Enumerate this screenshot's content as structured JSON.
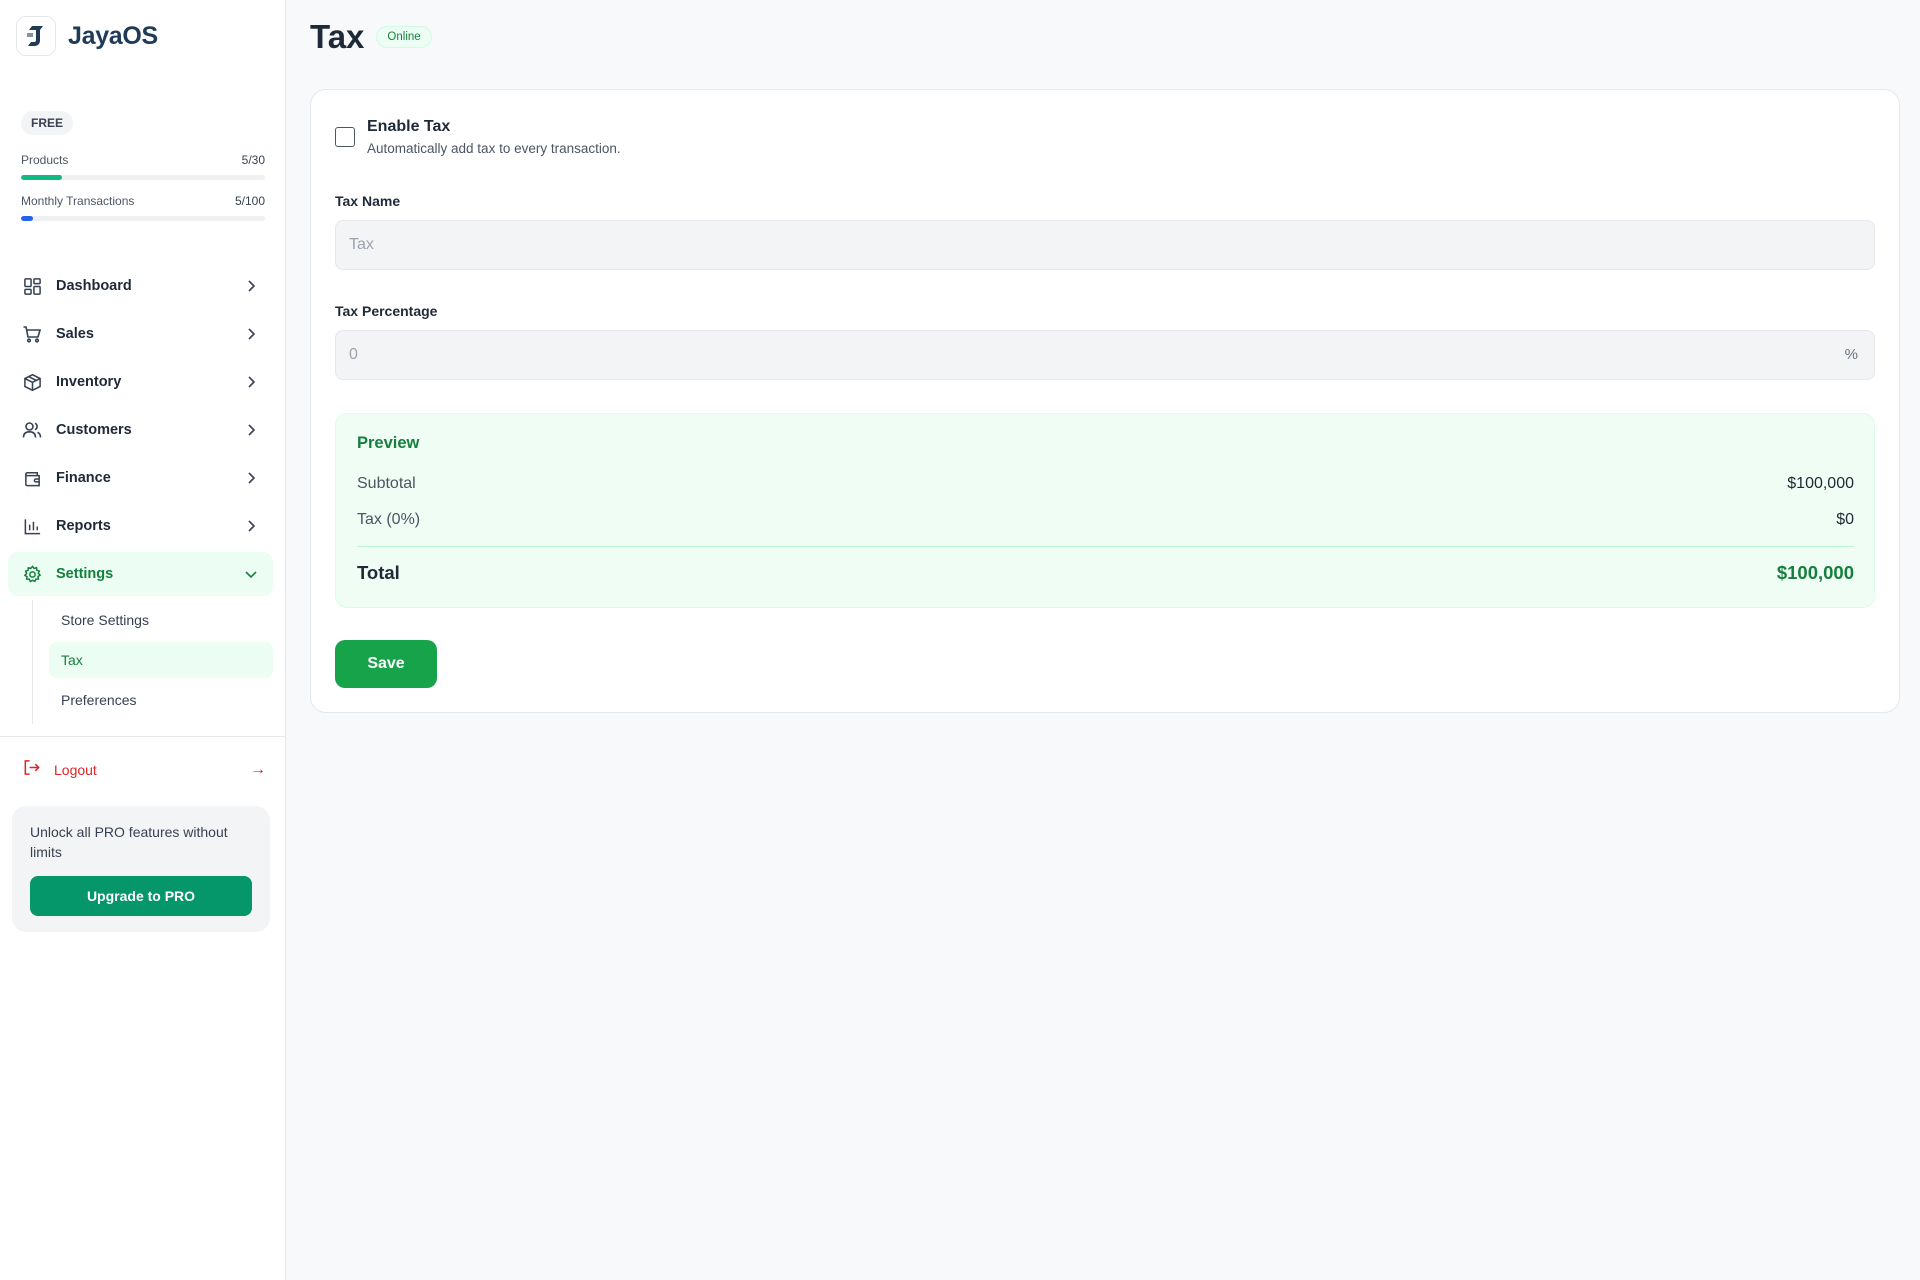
{
  "brand": {
    "name": "JayaOS"
  },
  "plan": {
    "badge": "FREE",
    "usage": [
      {
        "label": "Products",
        "count": "5/30",
        "fraction": 0.1667,
        "color": "#10b981"
      },
      {
        "label": "Monthly Transactions",
        "count": "5/100",
        "fraction": 0.05,
        "color": "#2563eb"
      }
    ]
  },
  "nav": {
    "items": [
      {
        "label": "Dashboard",
        "icon": "dashboard-icon"
      },
      {
        "label": "Sales",
        "icon": "cart-icon"
      },
      {
        "label": "Inventory",
        "icon": "box-icon"
      },
      {
        "label": "Customers",
        "icon": "users-icon"
      },
      {
        "label": "Finance",
        "icon": "wallet-icon"
      },
      {
        "label": "Reports",
        "icon": "bar-chart-icon"
      },
      {
        "label": "Settings",
        "icon": "gear-icon",
        "expanded": true
      }
    ],
    "settings_sub": [
      {
        "label": "Store Settings"
      },
      {
        "label": "Tax",
        "active": true
      },
      {
        "label": "Preferences"
      }
    ]
  },
  "logout": {
    "label": "Logout",
    "arrow": "→"
  },
  "promo": {
    "text": "Unlock all PRO features without limits",
    "button": "Upgrade to PRO"
  },
  "page": {
    "title": "Tax",
    "status": "Online"
  },
  "form": {
    "enable": {
      "title": "Enable Tax",
      "description": "Automatically add tax to every transaction.",
      "checked": false
    },
    "tax_name": {
      "label": "Tax Name",
      "placeholder": "Tax",
      "value": ""
    },
    "tax_percentage": {
      "label": "Tax Percentage",
      "placeholder": "0",
      "value": "",
      "suffix": "%"
    },
    "save_label": "Save"
  },
  "preview": {
    "title": "Preview",
    "subtotal_label": "Subtotal",
    "subtotal_value": "$100,000",
    "tax_label": "Tax (0%)",
    "tax_value": "$0",
    "total_label": "Total",
    "total_value": "$100,000"
  },
  "colors": {
    "accent": "#16a34a",
    "brand": "#1f3b57",
    "danger": "#dc2626",
    "upgrade": "#059669"
  }
}
